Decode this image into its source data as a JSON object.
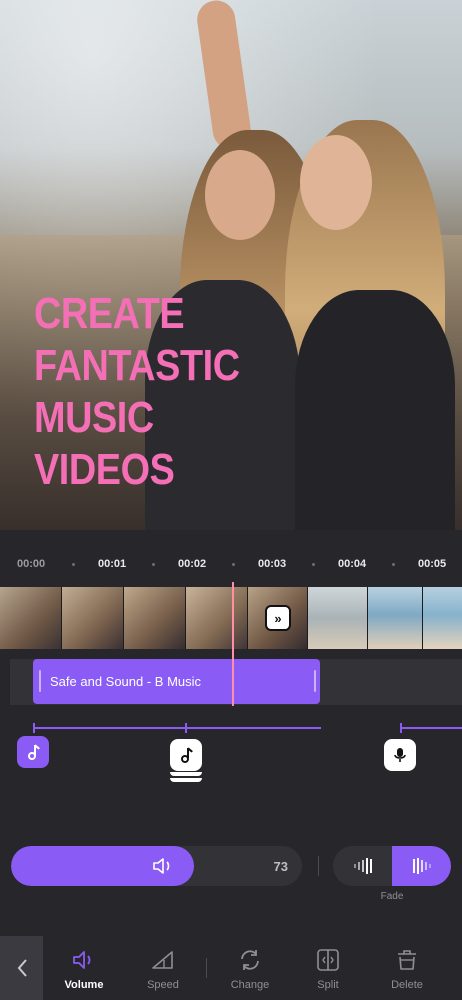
{
  "preview": {
    "headline_lines": [
      "CREATE",
      "FANTASTIC",
      "MUSIC",
      "VIDEOS"
    ]
  },
  "timeline": {
    "ticks": [
      "00:00",
      "00:01",
      "00:02",
      "00:03",
      "00:04",
      "00:05"
    ]
  },
  "music_track": {
    "title": "Safe and Sound - B Music"
  },
  "volume": {
    "value": "73",
    "level_percent": 63
  },
  "fade": {
    "label": "Fade",
    "selected": "fade-in"
  },
  "toolbar": {
    "items": [
      {
        "label": "Volume",
        "icon": "speaker-icon",
        "active": true
      },
      {
        "label": "Speed",
        "icon": "speed-icon",
        "active": false
      },
      {
        "label": "Change",
        "icon": "refresh-icon",
        "active": false
      },
      {
        "label": "Split",
        "icon": "split-icon",
        "active": false
      },
      {
        "label": "Delete",
        "icon": "trash-icon",
        "active": false
      }
    ]
  },
  "colors": {
    "accent": "#8a5cf5",
    "headline": "#f46fb5",
    "playhead": "#ff8fa8",
    "background": "#27272b"
  }
}
